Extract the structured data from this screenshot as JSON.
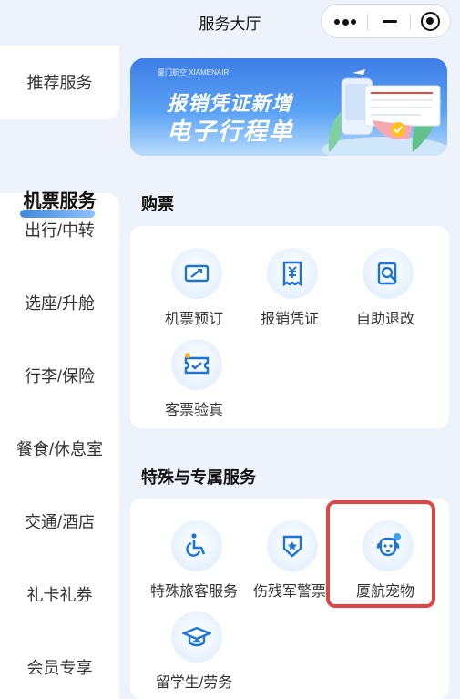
{
  "header": {
    "title": "服务大厅"
  },
  "capsule": {
    "more_icon": "more-dots-icon",
    "minimize_icon": "minimize-icon",
    "close_icon": "target-close-icon"
  },
  "sidebar": {
    "items": [
      {
        "label": "推荐服务"
      },
      {
        "label": "机票服务",
        "active": true
      },
      {
        "label": "出行/中转"
      },
      {
        "label": "选座/升舱"
      },
      {
        "label": "行李/保险"
      },
      {
        "label": "餐食/休息室"
      },
      {
        "label": "交通/酒店"
      },
      {
        "label": "礼卡礼券"
      },
      {
        "label": "会员专享"
      }
    ]
  },
  "banner": {
    "logo": "厦门航空 XIAMENAIR",
    "line1": "报销凭证新增",
    "line2": "电子行程单"
  },
  "sections": [
    {
      "title": "购票",
      "items": [
        {
          "label": "机票预订",
          "icon": "ticket-icon"
        },
        {
          "label": "报销凭证",
          "icon": "receipt-icon"
        },
        {
          "label": "自助退改",
          "icon": "search-document-icon"
        },
        {
          "label": "客票验真",
          "icon": "ticket-verify-icon"
        }
      ]
    },
    {
      "title": "特殊与专属服务",
      "items": [
        {
          "label": "特殊旅客服务",
          "icon": "wheelchair-icon"
        },
        {
          "label": "伤残军警票",
          "icon": "military-badge-icon"
        },
        {
          "label": "厦航宠物",
          "icon": "dog-icon"
        },
        {
          "label": "留学生/劳务",
          "icon": "graduation-cap-icon"
        }
      ]
    }
  ],
  "colors": {
    "accent": "#1d73d6",
    "highlight": "#e04545",
    "page_bg": "#eef3fb"
  }
}
